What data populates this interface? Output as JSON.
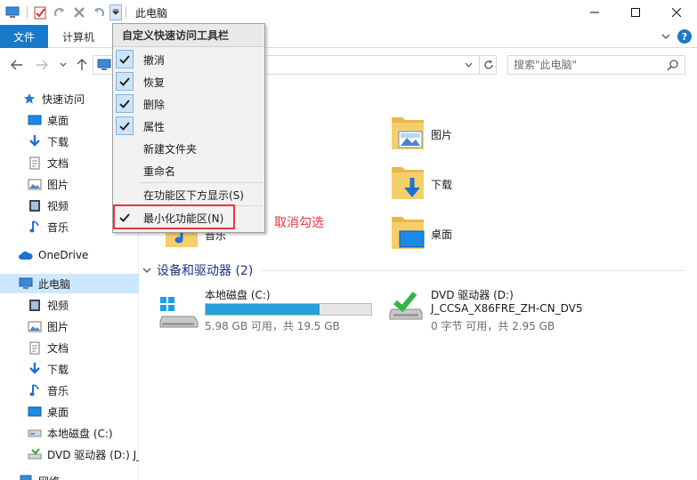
{
  "window": {
    "title": "此电脑"
  },
  "ribbon": {
    "file_tab": "文件",
    "computer_tab": "计算机",
    "help": "?"
  },
  "search": {
    "placeholder": "搜索\"此电脑\""
  },
  "qat_menu": {
    "title": "自定义快速访问工具栏",
    "items": [
      {
        "label": "撤消",
        "checked": true
      },
      {
        "label": "恢复",
        "checked": true
      },
      {
        "label": "删除",
        "checked": true
      },
      {
        "label": "属性",
        "checked": true
      },
      {
        "label": "新建文件夹",
        "checked": false
      },
      {
        "label": "重命名",
        "checked": false
      },
      {
        "label": "在功能区下方显示(S)",
        "checked": false
      },
      {
        "label": "最小化功能区(N)",
        "checked": true
      }
    ]
  },
  "annotation": "取消勾选",
  "nav": {
    "quick_access": "快速访问",
    "items": [
      "桌面",
      "下载",
      "文档",
      "图片",
      "视频",
      "音乐"
    ],
    "onedrive": "OneDrive",
    "this_pc": "此电脑",
    "pc_items": [
      "视频",
      "图片",
      "文档",
      "下载",
      "音乐",
      "桌面",
      "本地磁盘 (C:)",
      "DVD 驱动器 (D:) J_"
    ],
    "network": "网络"
  },
  "folders": [
    {
      "label": "音乐"
    },
    {
      "label": "图片"
    },
    {
      "label": "下载"
    },
    {
      "label": "桌面"
    }
  ],
  "group": {
    "title": "设备和驱动器 (2)"
  },
  "drives": [
    {
      "name": "本地磁盘 (C:)",
      "free": "5.98 GB 可用，共 19.5 GB",
      "used_pct": 69
    },
    {
      "name": "DVD 驱动器 (D:)",
      "volume": "J_CCSA_X86FRE_ZH-CN_DV5",
      "free": "0 字节 可用，共 2.95 GB"
    }
  ],
  "colors": {
    "accent": "#1979ca",
    "selection": "#cce8ff",
    "highlight": "#e4393c",
    "bar": "#26a0da"
  }
}
